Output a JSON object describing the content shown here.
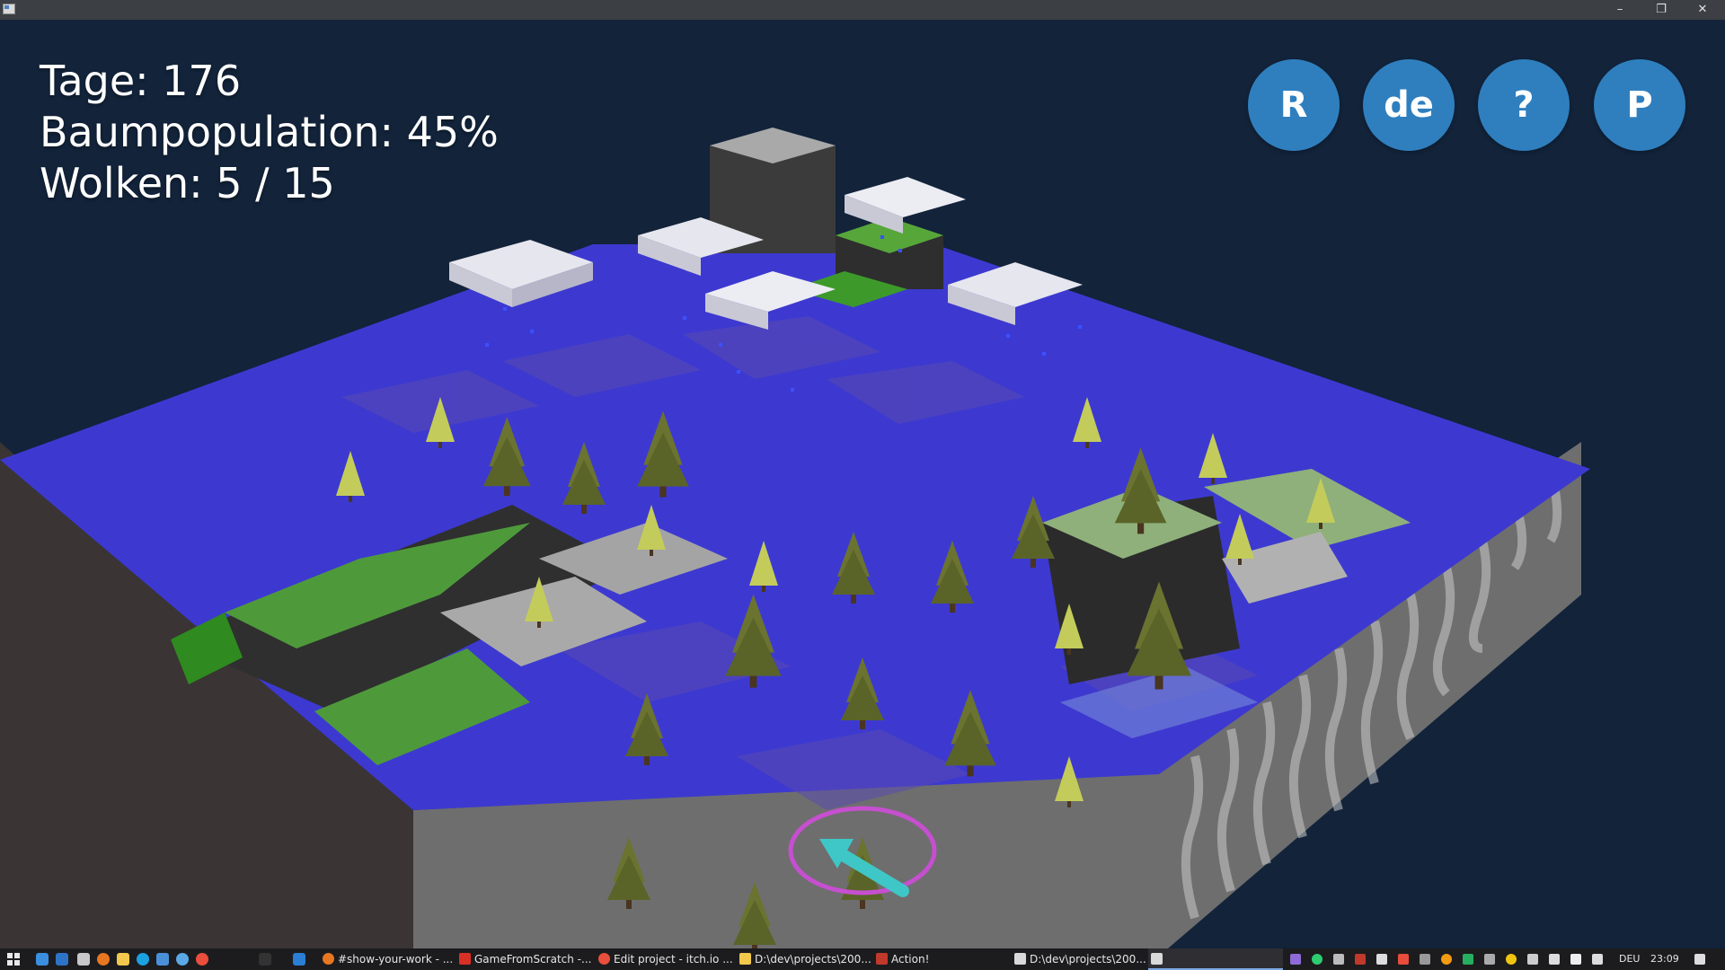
{
  "window": {
    "minimize": "–",
    "restore": "❐",
    "close": "✕"
  },
  "hud": {
    "days": "Tage: 176",
    "tree_population": "Baumpopulation: 45%",
    "clouds": "Wolken: 5 / 15"
  },
  "buttons": {
    "restart": "R",
    "language": "de",
    "help": "?",
    "pause": "P"
  },
  "taskbar": {
    "tasks": [
      "#show-your-work - ...",
      "GameFromScratch -...",
      "Edit project - itch.io ...",
      "D:\\dev\\projects\\200...",
      "Action!",
      "D:\\dev\\projects\\200..."
    ],
    "language": "DEU",
    "time": "23:09"
  },
  "colors": {
    "water": "#3b3fd6",
    "grass": "#4d9a3a",
    "rock": "#a8a8a8",
    "cloud": "#e6e6ee",
    "button": "#2f7fbf",
    "selection_ring": "#c64fd0",
    "arrow": "#3fc6c6"
  },
  "icons": [
    "restart-icon",
    "language-icon",
    "help-icon",
    "pause-icon",
    "wind-arrow-icon",
    "selection-ring-icon",
    "pine-tree-icon",
    "cloud-icon"
  ]
}
